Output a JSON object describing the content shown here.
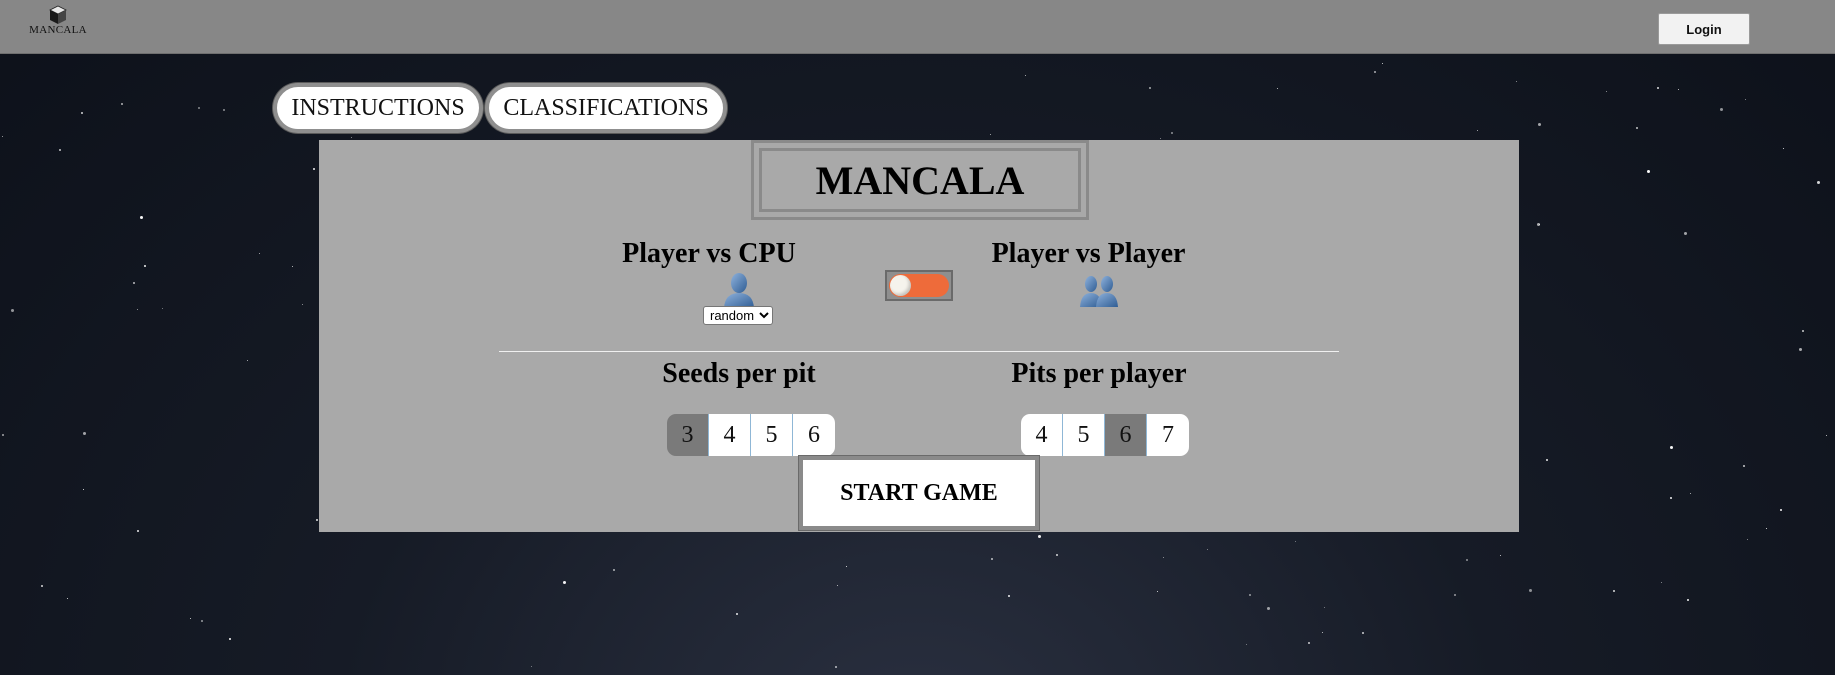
{
  "header": {
    "logo_text": "MANCALA",
    "login_label": "Login"
  },
  "nav": {
    "instructions_label": "INSTRUCTIONS",
    "classifications_label": "CLASSIFICATIONS"
  },
  "game_setup": {
    "title": "MANCALA",
    "mode_cpu_label": "Player vs CPU",
    "mode_pvp_label": "Player vs Player",
    "cpu_difficulty_selected": "random",
    "mode_toggle_state": "off",
    "seeds_label": "Seeds per pit",
    "seeds_options": [
      "3",
      "4",
      "5",
      "6"
    ],
    "seeds_selected": "3",
    "pits_label": "Pits per player",
    "pits_options": [
      "4",
      "5",
      "6",
      "7"
    ],
    "pits_selected": "6",
    "start_label": "START GAME"
  },
  "colors": {
    "topbar": "#878787",
    "panel": "#a9a9a9",
    "toggle_accent": "#ee6b3a",
    "selected_option": "#7a7a7a",
    "icon_blue": "#4a74a8"
  },
  "icons": {
    "logo": "cube-icon",
    "cpu_mode": "user-icon",
    "pvp_mode": "users-icon"
  }
}
